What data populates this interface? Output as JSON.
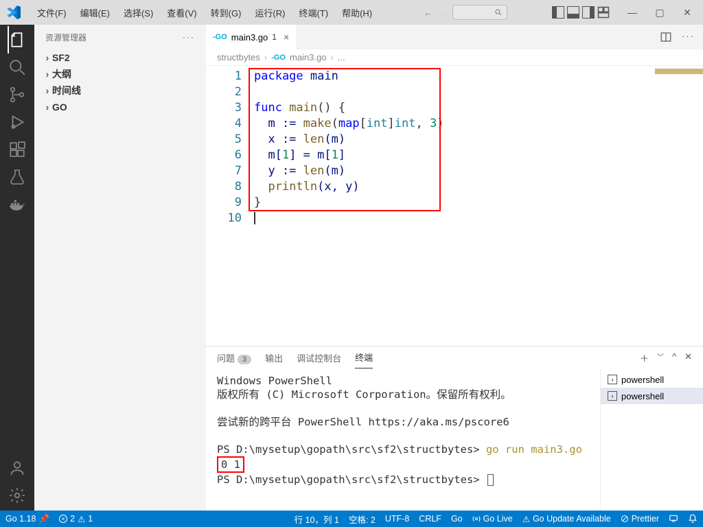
{
  "menu": {
    "items": [
      "文件(F)",
      "编辑(E)",
      "选择(S)",
      "查看(V)",
      "转到(G)",
      "运行(R)",
      "终端(T)",
      "帮助(H)"
    ]
  },
  "sidebar": {
    "title": "资源管理器",
    "items": [
      {
        "label": "SF2"
      },
      {
        "label": "大纲"
      },
      {
        "label": "时间线"
      },
      {
        "label": "GO"
      }
    ]
  },
  "tab": {
    "icon": "-GO",
    "filename": "main3.go",
    "modified": "1",
    "close": "×"
  },
  "breadcrumb": {
    "root": "structbytes",
    "file": "main3.go",
    "more": "..."
  },
  "code": {
    "line_start": 1,
    "line_end": 10,
    "l1_kw": "package",
    "l1_id": " main",
    "l3_kw": "func",
    "l3_fn": " main",
    "l3_rest": "() {",
    "l4_pre": "  m := ",
    "l4_make": "make",
    "l4_p1": "(",
    "l4_map": "map",
    "l4_b1": "[",
    "l4_int1": "int",
    "l4_b2": "]",
    "l4_int2": "int",
    "l4_c": ", ",
    "l4_n": "3",
    "l4_p2": ")",
    "l5_pre": "  x := ",
    "l5_len": "len",
    "l5_rest": "(m)",
    "l6_pre": "  m[",
    "l6_n1": "1",
    "l6_mid": "] = m[",
    "l6_n2": "1",
    "l6_end": "]",
    "l7_pre": "  y := ",
    "l7_len": "len",
    "l7_rest": "(m)",
    "l8_pre": "  ",
    "l8_fn": "println",
    "l8_rest": "(x, y)",
    "l9": "}"
  },
  "panel": {
    "tabs": {
      "problems": "问题",
      "problems_count": "3",
      "output": "输出",
      "debug": "调试控制台",
      "terminal": "终端"
    },
    "term_lines": {
      "l1": "Windows PowerShell",
      "l2": "版权所有 (C) Microsoft Corporation。保留所有权利。",
      "l3": "尝试新的跨平台 PowerShell https://aka.ms/pscore6",
      "l4p": "PS D:\\mysetup\\gopath\\src\\sf2\\structbytes> ",
      "l4c": "go run main3.go",
      "l5": "0 1",
      "l6p": "PS D:\\mysetup\\gopath\\src\\sf2\\structbytes> "
    },
    "sessions": [
      {
        "label": "powershell"
      },
      {
        "label": "powershell"
      }
    ]
  },
  "status": {
    "go": "Go 1.18",
    "errors": "2",
    "warnings": "1",
    "line_col": "行 10，列 1",
    "spaces": "空格: 2",
    "encoding": "UTF-8",
    "eol": "CRLF",
    "lang": "Go",
    "golive": "Go Live",
    "update": "Go Update Available",
    "prettier": "Prettier"
  }
}
